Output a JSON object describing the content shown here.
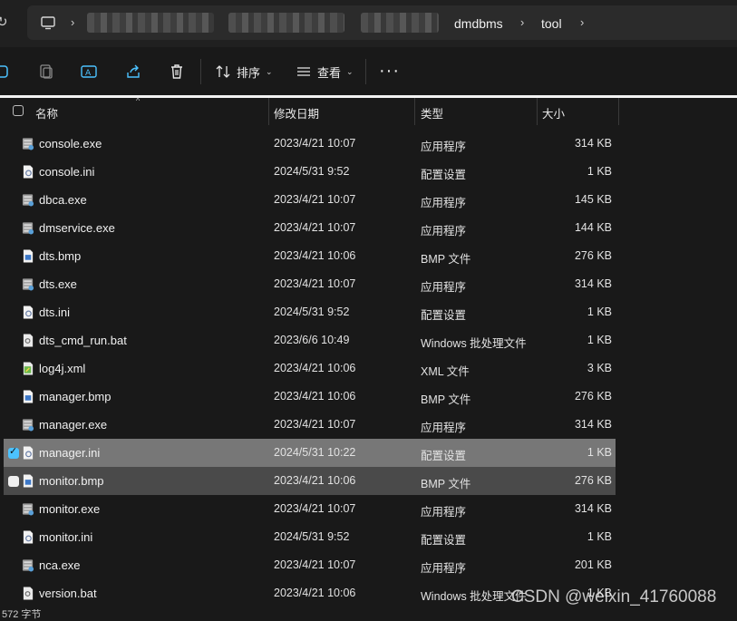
{
  "address": {
    "breadcrumb": [
      "dmdbms",
      "tool"
    ]
  },
  "toolbar": {
    "sort_label": "排序",
    "view_label": "查看",
    "more_label": "···"
  },
  "columns": {
    "name": "名称",
    "date": "修改日期",
    "type": "类型",
    "size": "大小"
  },
  "files": [
    {
      "name": "console.exe",
      "date": "2023/4/21 10:07",
      "type": "应用程序",
      "size": "314 KB",
      "icon": "exe-icon",
      "state": "normal"
    },
    {
      "name": "console.ini",
      "date": "2024/5/31 9:52",
      "type": "配置设置",
      "size": "1 KB",
      "icon": "ini-icon",
      "state": "normal"
    },
    {
      "name": "dbca.exe",
      "date": "2023/4/21 10:07",
      "type": "应用程序",
      "size": "145 KB",
      "icon": "exe-icon",
      "state": "normal"
    },
    {
      "name": "dmservice.exe",
      "date": "2023/4/21 10:07",
      "type": "应用程序",
      "size": "144 KB",
      "icon": "exe-icon",
      "state": "normal"
    },
    {
      "name": "dts.bmp",
      "date": "2023/4/21 10:06",
      "type": "BMP 文件",
      "size": "276 KB",
      "icon": "bmp-icon",
      "state": "normal"
    },
    {
      "name": "dts.exe",
      "date": "2023/4/21 10:07",
      "type": "应用程序",
      "size": "314 KB",
      "icon": "exe-icon",
      "state": "normal"
    },
    {
      "name": "dts.ini",
      "date": "2024/5/31 9:52",
      "type": "配置设置",
      "size": "1 KB",
      "icon": "ini-icon",
      "state": "normal"
    },
    {
      "name": "dts_cmd_run.bat",
      "date": "2023/6/6 10:49",
      "type": "Windows 批处理文件",
      "size": "1 KB",
      "icon": "bat-icon",
      "state": "normal"
    },
    {
      "name": "log4j.xml",
      "date": "2023/4/21 10:06",
      "type": "XML 文件",
      "size": "3 KB",
      "icon": "xml-icon",
      "state": "normal"
    },
    {
      "name": "manager.bmp",
      "date": "2023/4/21 10:06",
      "type": "BMP 文件",
      "size": "276 KB",
      "icon": "bmp-icon",
      "state": "normal"
    },
    {
      "name": "manager.exe",
      "date": "2023/4/21 10:07",
      "type": "应用程序",
      "size": "314 KB",
      "icon": "exe-icon",
      "state": "normal"
    },
    {
      "name": "manager.ini",
      "date": "2024/5/31 10:22",
      "type": "配置设置",
      "size": "1 KB",
      "icon": "ini-icon",
      "state": "selected"
    },
    {
      "name": "monitor.bmp",
      "date": "2023/4/21 10:06",
      "type": "BMP 文件",
      "size": "276 KB",
      "icon": "bmp-icon",
      "state": "hover"
    },
    {
      "name": "monitor.exe",
      "date": "2023/4/21 10:07",
      "type": "应用程序",
      "size": "314 KB",
      "icon": "exe-icon",
      "state": "normal"
    },
    {
      "name": "monitor.ini",
      "date": "2024/5/31 9:52",
      "type": "配置设置",
      "size": "1 KB",
      "icon": "ini-icon",
      "state": "normal"
    },
    {
      "name": "nca.exe",
      "date": "2023/4/21 10:07",
      "type": "应用程序",
      "size": "201 KB",
      "icon": "exe-icon",
      "state": "normal"
    },
    {
      "name": "version.bat",
      "date": "2023/4/21 10:06",
      "type": "Windows 批处理文件",
      "size": "1 KB",
      "icon": "bat-icon",
      "state": "normal"
    }
  ],
  "status": {
    "text": "572 字节"
  },
  "watermark": "CSDN @weixin_41760088",
  "colors": {
    "selected_row": "#777777",
    "hover_row": "#4a4a4a",
    "accent": "#4cc2ff"
  }
}
